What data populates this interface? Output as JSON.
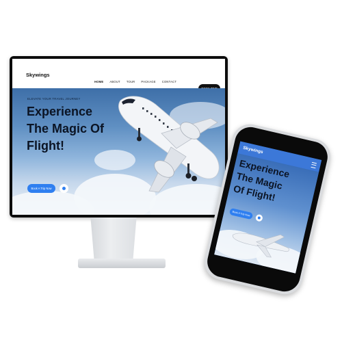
{
  "desktop": {
    "brand": "Skywings",
    "nav": [
      "HOME",
      "ABOUT",
      "TOUR",
      "PACKAGE",
      "CONTACT"
    ],
    "active_nav": "HOME",
    "nav_button": "BOOK TRIP",
    "eyebrow": "ELEVATE YOUR TRAVEL JOURNEY",
    "headline_lines": [
      "Experience",
      "The Magic Of",
      "Flight!"
    ],
    "cta": "Book A Trip Now"
  },
  "mobile": {
    "brand": "Skywings",
    "headline_lines": [
      "Experience",
      "The Magic",
      "Of Flight!"
    ],
    "cta": "Book A Trip Now"
  },
  "colors": {
    "accent": "#2f7ff0",
    "nav_button": "#111111",
    "sky": "#5f8fc2",
    "mobile_nav": "#3c78d8"
  },
  "icons": {
    "play": "play-circle-icon",
    "menu": "hamburger-menu-icon",
    "airplane": "airplane-image"
  }
}
